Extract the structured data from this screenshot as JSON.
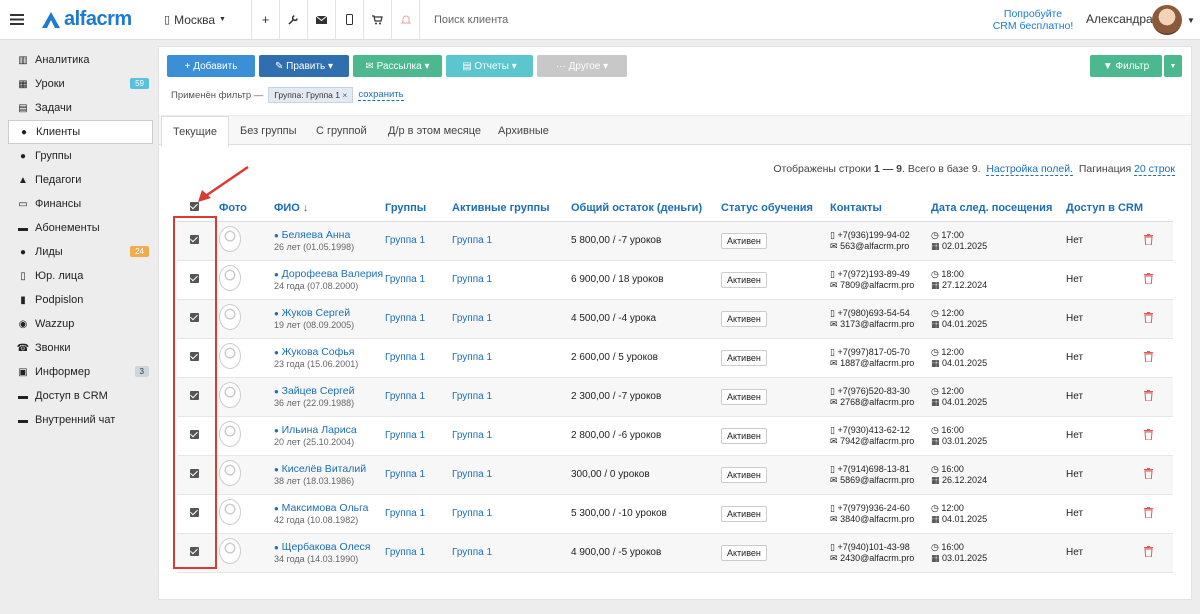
{
  "header": {
    "menu_icon": "hamburger-icon",
    "logo_text": "alfacrm",
    "city": "Москва",
    "search_placeholder": "Поиск клиента",
    "try_line1": "Попробуйте",
    "try_line2": "CRM бесплатно!",
    "user_name": "Александра"
  },
  "sidebar": {
    "items": [
      {
        "label": "Аналитика",
        "icon": "chart-icon"
      },
      {
        "label": "Уроки",
        "icon": "calendar-icon",
        "badge": "59",
        "badge_color": "#5bc0de"
      },
      {
        "label": "Задачи",
        "icon": "clipboard-icon"
      },
      {
        "label": "Клиенты",
        "icon": "user-icon",
        "active": true
      },
      {
        "label": "Группы",
        "icon": "users-icon"
      },
      {
        "label": "Педагоги",
        "icon": "graduation-icon"
      },
      {
        "label": "Финансы",
        "icon": "money-icon"
      },
      {
        "label": "Абонементы",
        "icon": "ticket-icon"
      },
      {
        "label": "Лиды",
        "icon": "lead-icon",
        "badge": "24",
        "badge_color": "#f0ad4e"
      },
      {
        "label": "Юр. лица",
        "icon": "building-icon"
      },
      {
        "label": "Podpislon",
        "icon": "document-icon"
      },
      {
        "label": "Wazzup",
        "icon": "whatsapp-icon"
      },
      {
        "label": "Звонки",
        "icon": "phone-icon"
      },
      {
        "label": "Информер",
        "icon": "bell-icon",
        "badge": "3",
        "badge_color": "#ccd6dd"
      },
      {
        "label": "Доступ в CRM",
        "icon": "lock-icon"
      },
      {
        "label": "Внутренний чат",
        "icon": "chat-icon"
      }
    ]
  },
  "toolbar": {
    "add": "+ Добавить",
    "edit": "✎ Править ▾",
    "mailing": "✉ Рассылка ▾",
    "reports": "▤ Отчеты ▾",
    "other": "··· Другое ▾",
    "filter": "▼ Фильтр",
    "add_color": "#3a8fd6",
    "edit_color": "#2f6fb0",
    "mailing_color": "#4cb88f",
    "reports_color": "#5cc6cf",
    "other_color": "#c8c8c8",
    "filter_color": "#4cb88f"
  },
  "filter_line": {
    "prefix": "Применён фильтр —",
    "chip": "Группа: Группа 1",
    "chip_close": "×",
    "save": "сохранить"
  },
  "tabs": [
    "Текущие",
    "Без группы",
    "С группой",
    "Д/р в этом месяце",
    "Архивные"
  ],
  "info": {
    "shown_prefix": "Отображены строки",
    "shown_range": "1 — 9",
    "total_text": "Всего в базе 9.",
    "fields_link": "Настройка полей.",
    "pagination_label": "Пагинация",
    "pagination_value": "20 строк"
  },
  "table": {
    "columns": [
      "Фото",
      "ФИО ↓",
      "Группы",
      "Активные группы",
      "Общий остаток (деньги)",
      "Статус обучения",
      "Контакты",
      "Дата след. посещения",
      "Доступ в CRM"
    ],
    "rows": [
      {
        "name": "Беляева Анна",
        "age": "26 лет (01.05.1998)",
        "group": "Группа 1",
        "active": "Группа 1",
        "balance": "5 800,00 / -7 уроков",
        "status": "Активен",
        "phone": "+7(936)199-94-02",
        "email": "563@alfacrm.pro",
        "time": "17:00",
        "date": "02.01.2025",
        "access": "Нет"
      },
      {
        "name": "Дорофеева Валерия",
        "age": "24 года (07.08.2000)",
        "group": "Группа 1",
        "active": "Группа 1",
        "balance": "6 900,00 / 18 уроков",
        "status": "Активен",
        "phone": "+7(972)193-89-49",
        "email": "7809@alfacrm.pro",
        "time": "18:00",
        "date": "27.12.2024",
        "access": "Нет"
      },
      {
        "name": "Жуков Сергей",
        "age": "19 лет (08.09.2005)",
        "group": "Группа 1",
        "active": "Группа 1",
        "balance": "4 500,00 / -4 урока",
        "status": "Активен",
        "phone": "+7(980)693-54-54",
        "email": "3173@alfacrm.pro",
        "time": "12:00",
        "date": "04.01.2025",
        "access": "Нет"
      },
      {
        "name": "Жукова Софья",
        "age": "23 года (15.06.2001)",
        "group": "Группа 1",
        "active": "Группа 1",
        "balance": "2 600,00 / 5 уроков",
        "status": "Активен",
        "phone": "+7(997)817-05-70",
        "email": "1887@alfacrm.pro",
        "time": "12:00",
        "date": "04.01.2025",
        "access": "Нет"
      },
      {
        "name": "Зайцев Сергей",
        "age": "36 лет (22.09.1988)",
        "group": "Группа 1",
        "active": "Группа 1",
        "balance": "2 300,00 / -7 уроков",
        "status": "Активен",
        "phone": "+7(976)520-83-30",
        "email": "2768@alfacrm.pro",
        "time": "12:00",
        "date": "04.01.2025",
        "access": "Нет"
      },
      {
        "name": "Ильина Лариса",
        "age": "20 лет (25.10.2004)",
        "group": "Группа 1",
        "active": "Группа 1",
        "balance": "2 800,00 / -6 уроков",
        "status": "Активен",
        "phone": "+7(930)413-62-12",
        "email": "7942@alfacrm.pro",
        "time": "16:00",
        "date": "03.01.2025",
        "access": "Нет"
      },
      {
        "name": "Киселёв Виталий",
        "age": "38 лет (18.03.1986)",
        "group": "Группа 1",
        "active": "Группа 1",
        "balance": "300,00 / 0 уроков",
        "status": "Активен",
        "phone": "+7(914)698-13-81",
        "email": "5869@alfacrm.pro",
        "time": "16:00",
        "date": "26.12.2024",
        "access": "Нет"
      },
      {
        "name": "Максимова Ольга",
        "age": "42 года (10.08.1982)",
        "group": "Группа 1",
        "active": "Группа 1",
        "balance": "5 300,00 / -10 уроков",
        "status": "Активен",
        "phone": "+7(979)936-24-60",
        "email": "3840@alfacrm.pro",
        "time": "12:00",
        "date": "04.01.2025",
        "access": "Нет"
      },
      {
        "name": "Щербакова Олеся",
        "age": "34 года (14.03.1990)",
        "group": "Группа 1",
        "active": "Группа 1",
        "balance": "4 900,00 / -5 уроков",
        "status": "Активен",
        "phone": "+7(940)101-43-98",
        "email": "2430@alfacrm.pro",
        "time": "16:00",
        "date": "03.01.2025",
        "access": "Нет"
      }
    ]
  },
  "annotation_color": "#d93a32"
}
